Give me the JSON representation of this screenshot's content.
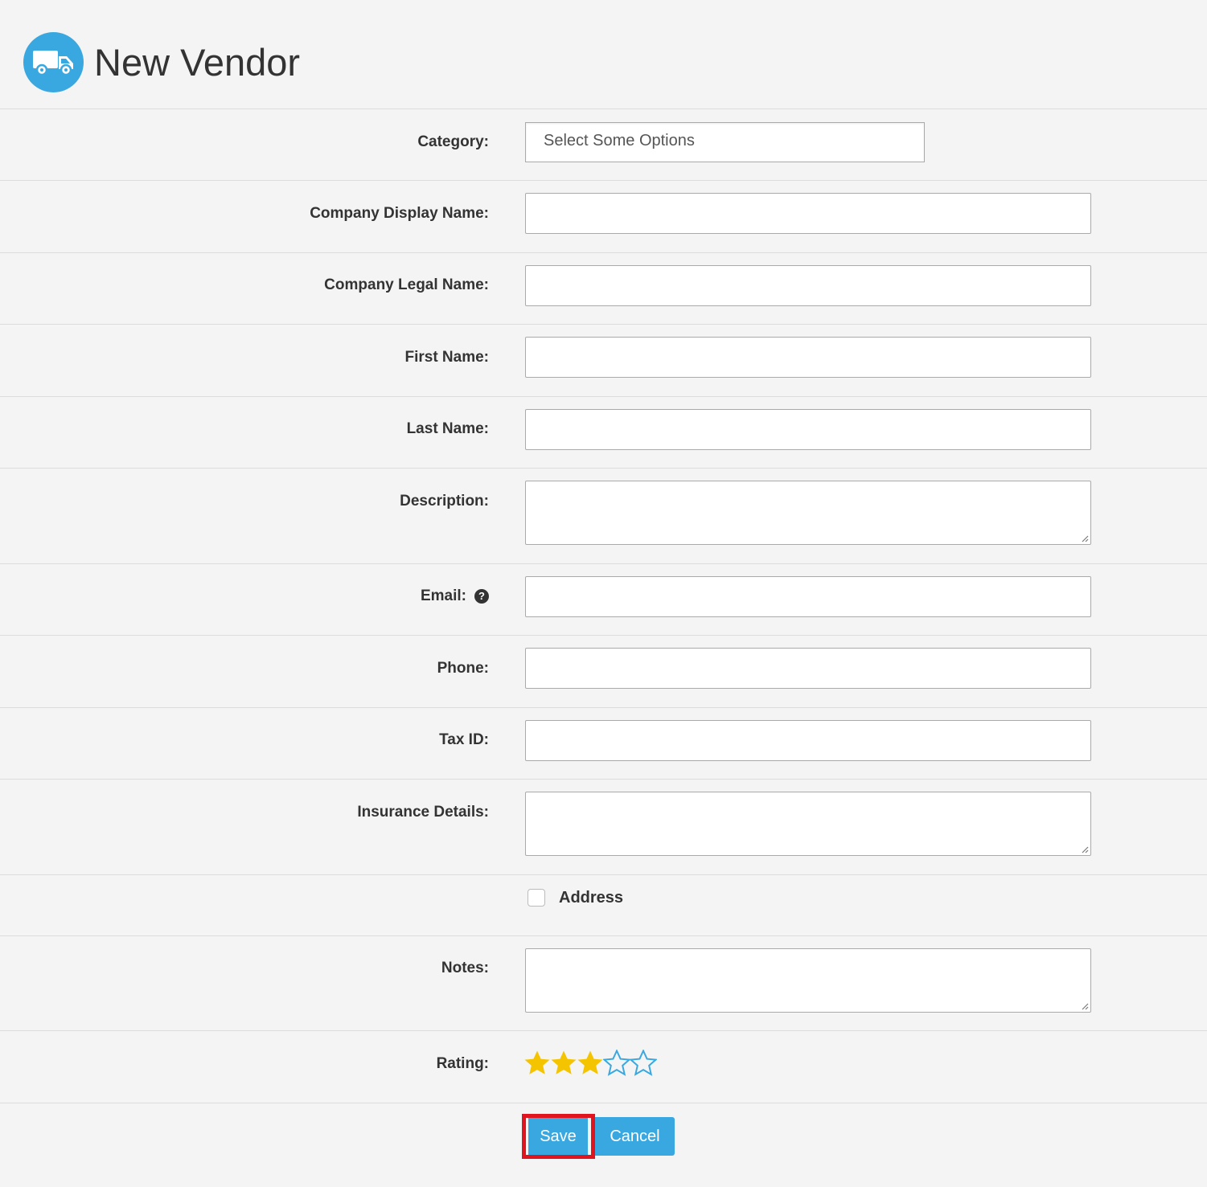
{
  "header": {
    "title": "New Vendor",
    "icon": "truck-icon",
    "accent_color": "#3aa8e0"
  },
  "form": {
    "category": {
      "label": "Category:",
      "placeholder": "Select Some Options"
    },
    "company_display_name": {
      "label": "Company Display Name:",
      "value": ""
    },
    "company_legal_name": {
      "label": "Company Legal Name:",
      "value": ""
    },
    "first_name": {
      "label": "First Name:",
      "value": ""
    },
    "last_name": {
      "label": "Last Name:",
      "value": ""
    },
    "description": {
      "label": "Description:",
      "value": ""
    },
    "email": {
      "label": "Email:",
      "help_icon": "question-circle-icon",
      "value": ""
    },
    "phone": {
      "label": "Phone:",
      "value": ""
    },
    "tax_id": {
      "label": "Tax ID:",
      "value": ""
    },
    "insurance_details": {
      "label": "Insurance Details:",
      "value": ""
    },
    "address": {
      "label": "Address",
      "checked": false
    },
    "notes": {
      "label": "Notes:",
      "value": ""
    },
    "rating": {
      "label": "Rating:",
      "value": 3,
      "max": 5,
      "filled_color": "#f5c400",
      "empty_color": "#3aa8e0"
    }
  },
  "actions": {
    "save_label": "Save",
    "cancel_label": "Cancel",
    "highlight_color": "#e0141e"
  }
}
